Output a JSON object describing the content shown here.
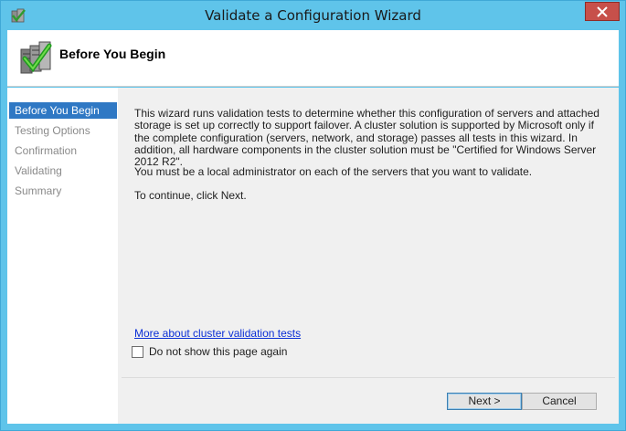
{
  "window": {
    "title": "Validate a Configuration Wizard",
    "close_label": "✕"
  },
  "header": {
    "title": "Before You Begin"
  },
  "steps": {
    "items": [
      {
        "label": "Before You Begin",
        "active": true
      },
      {
        "label": "Testing Options",
        "active": false
      },
      {
        "label": "Confirmation",
        "active": false
      },
      {
        "label": "Validating",
        "active": false
      },
      {
        "label": "Summary",
        "active": false
      }
    ]
  },
  "body": {
    "intro": "This wizard runs validation tests to determine whether this configuration of servers and attached storage is set up correctly to support failover. A cluster solution is supported by Microsoft only if the complete configuration (servers, network, and storage) passes all tests in this wizard. In addition, all hardware components in the cluster solution must be \"Certified for Windows Server 2012 R2\".",
    "admin_note": "You must be a local administrator on each of the servers that you want to validate.",
    "continue_note": "To continue, click Next.",
    "link": "More about cluster validation tests",
    "checkbox_label": "Do not show this page again",
    "checkbox_checked": false
  },
  "buttons": {
    "next": "Next >",
    "cancel": "Cancel"
  },
  "colors": {
    "frame": "#5fc4ea",
    "active_step": "#2f78c4",
    "close": "#c7504a",
    "link": "#0b2fd6"
  },
  "icons": {
    "title": "cluster-validate-icon",
    "header": "server-check-icon",
    "close": "close-icon"
  }
}
